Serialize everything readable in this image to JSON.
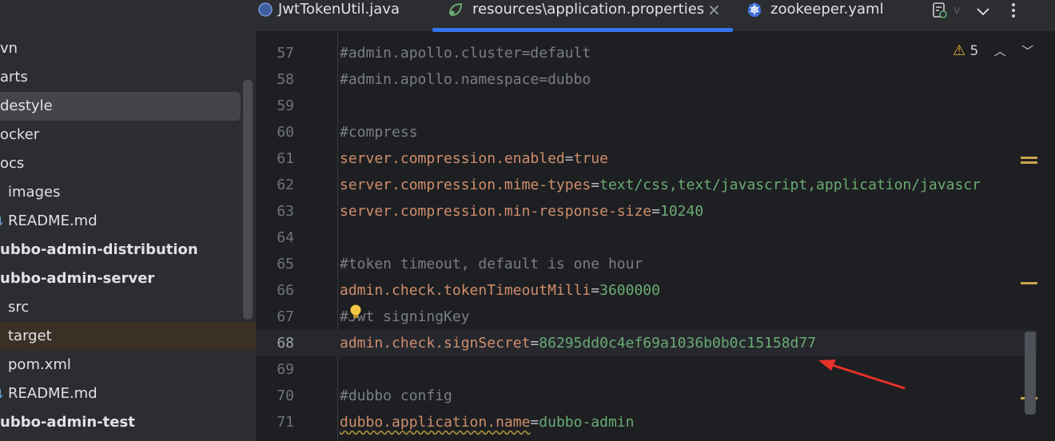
{
  "project_tree": {
    "items": [
      {
        "label": "vn",
        "icon": "",
        "bold": false,
        "state": "normal"
      },
      {
        "label": "arts",
        "icon": "",
        "bold": false,
        "state": "normal"
      },
      {
        "label": "destyle",
        "icon": "",
        "bold": false,
        "state": "selected"
      },
      {
        "label": "ocker",
        "icon": "",
        "bold": false,
        "state": "normal"
      },
      {
        "label": "ocs",
        "icon": "",
        "bold": false,
        "state": "normal"
      },
      {
        "label": "images",
        "icon": "folder-icon",
        "bold": false,
        "state": "normal"
      },
      {
        "label": "README.md",
        "icon": "markdown-icon",
        "bold": false,
        "state": "normal"
      },
      {
        "label": "ubbo-admin-distribution",
        "icon": "",
        "bold": true,
        "state": "normal"
      },
      {
        "label": "ubbo-admin-server",
        "icon": "",
        "bold": true,
        "state": "normal"
      },
      {
        "label": "src",
        "icon": "folder-icon",
        "bold": false,
        "state": "normal"
      },
      {
        "label": "target",
        "icon": "folder-excluded-icon",
        "bold": false,
        "state": "excluded"
      },
      {
        "label": "pom.xml",
        "icon": "maven-icon",
        "bold": false,
        "state": "normal"
      },
      {
        "label": "README.md",
        "icon": "markdown-icon",
        "bold": false,
        "state": "normal"
      },
      {
        "label": "ubbo-admin-test",
        "icon": "",
        "bold": true,
        "state": "normal"
      }
    ]
  },
  "tabs": [
    {
      "label": "JwtTokenUtil.java",
      "icon": "java-class-icon",
      "active": false
    },
    {
      "label": "resources\\application.properties",
      "icon": "spring-properties-icon",
      "active": true
    },
    {
      "label": "zookeeper.yaml",
      "icon": "kubernetes-icon",
      "active": false
    }
  ],
  "toolbar": {
    "close_glyph": "×"
  },
  "inspections": {
    "warning_count": "5"
  },
  "editor": {
    "current_line": "68",
    "lines": [
      {
        "num": "57",
        "tokens": [
          {
            "t": "#admin.apollo.cluster=default",
            "k": "comment"
          }
        ]
      },
      {
        "num": "58",
        "tokens": [
          {
            "t": "#admin.apollo.namespace=dubbo",
            "k": "comment"
          }
        ]
      },
      {
        "num": "59",
        "tokens": []
      },
      {
        "num": "60",
        "tokens": [
          {
            "t": "#compress",
            "k": "comment"
          }
        ]
      },
      {
        "num": "61",
        "tokens": [
          {
            "t": "server.compression.enabled",
            "k": "key"
          },
          {
            "t": "=",
            "k": "eq"
          },
          {
            "t": "true",
            "k": "key"
          }
        ]
      },
      {
        "num": "62",
        "tokens": [
          {
            "t": "server.compression.mime-types",
            "k": "key"
          },
          {
            "t": "=",
            "k": "eq"
          },
          {
            "t": "text/css,text/javascript,application/javascr",
            "k": "val"
          }
        ]
      },
      {
        "num": "63",
        "tokens": [
          {
            "t": "server.compression.min-response-size",
            "k": "key"
          },
          {
            "t": "=",
            "k": "eq"
          },
          {
            "t": "10240",
            "k": "val"
          }
        ]
      },
      {
        "num": "64",
        "tokens": []
      },
      {
        "num": "65",
        "tokens": [
          {
            "t": "#token timeout, default is one hour",
            "k": "comment"
          }
        ]
      },
      {
        "num": "66",
        "tokens": [
          {
            "t": "admin.check.tokenTimeoutMilli",
            "k": "key"
          },
          {
            "t": "=",
            "k": "eq"
          },
          {
            "t": "3600000",
            "k": "val"
          }
        ]
      },
      {
        "num": "67",
        "tokens": [
          {
            "t": "#Jwt signingKey",
            "k": "comment"
          }
        ]
      },
      {
        "num": "68",
        "tokens": [
          {
            "t": "admin.check.signSecret",
            "k": "key"
          },
          {
            "t": "=",
            "k": "eq"
          },
          {
            "t": "86295dd0c4ef69a1036b0b0c15158d77",
            "k": "val"
          }
        ]
      },
      {
        "num": "69",
        "tokens": []
      },
      {
        "num": "70",
        "tokens": [
          {
            "t": "#dubbo config",
            "k": "comment"
          }
        ]
      },
      {
        "num": "71",
        "tokens": [
          {
            "t": "dubbo.application.name",
            "k": "key underline"
          },
          {
            "t": "=",
            "k": "eq"
          },
          {
            "t": "dubbo-admin",
            "k": "val"
          }
        ]
      }
    ]
  },
  "colors": {
    "accent": "#3574f0",
    "comment": "#7a7e85",
    "key": "#cf8e6d",
    "value": "#6aab73",
    "annotation_arrow": "#e8312a",
    "warning": "#f0b43c"
  }
}
